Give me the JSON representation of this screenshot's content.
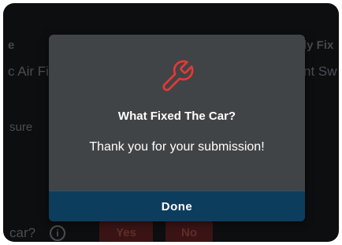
{
  "background": {
    "header_left": "e",
    "header_right": "ly Fix",
    "row1_left": "c Air Fi",
    "row1_right": "nt Sw",
    "row2_left": "sure",
    "question": "car?",
    "info_icon": "info-icon",
    "yes_label": "Yes",
    "no_label": "No"
  },
  "modal": {
    "icon": "wrench-icon",
    "icon_color": "#e53935",
    "title": "What Fixed The Car?",
    "message": "Thank you for your submission!",
    "done_label": "Done",
    "button_color": "#0d3d5c"
  }
}
